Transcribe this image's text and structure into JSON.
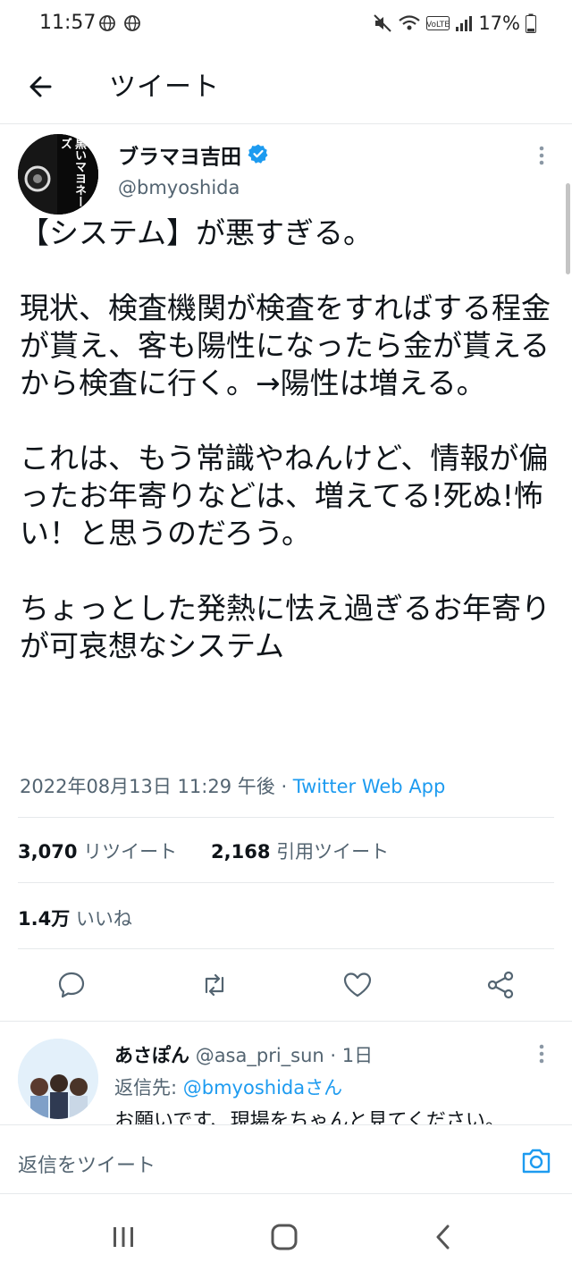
{
  "status_bar": {
    "time": "11:57",
    "battery": "17%",
    "icons": [
      "globe-icon",
      "globe-icon",
      "mute-icon",
      "wifi-icon",
      "volte-icon",
      "signal-icon",
      "battery-icon"
    ]
  },
  "header": {
    "title": "ツイート",
    "back_icon": "arrow-left-icon"
  },
  "tweet": {
    "author_name": "ブラマヨ吉田",
    "author_handle": "@bmyoshida",
    "avatar_text": "黒いマヨネーズ",
    "body": "【システム】が悪すぎる。\n\n現状、検査機関が検査をすればする程金が貰え、客も陽性になったら金が貰えるから検査に行く。→陽性は増える。\n\nこれは、もう常識やねんけど、情報が偏ったお年寄りなどは、増えてる!死ぬ!怖い！と思うのだろう。\n\nちょっとした発熱に怯え過ぎるお年寄りが可哀想なシステム",
    "timestamp": "2022年08月13日 11:29 午後",
    "separator": " · ",
    "source": "Twitter Web App",
    "retweets_count": "3,070",
    "retweets_label": "リツイート",
    "quotes_count": "2,168",
    "quotes_label": "引用ツイート",
    "likes_count": "1.4万",
    "likes_label": "いいね"
  },
  "reply": {
    "name": "あさぽん",
    "handle": "@asa_pri_sun",
    "time": "· 1日",
    "reply_to_label": "返信先:",
    "reply_to_handle": "@bmyoshidaさん",
    "text": "お願いです、現場をちゃんと見てください。"
  },
  "compose": {
    "placeholder": "返信をツイート"
  },
  "colors": {
    "accent": "#1d9bf0",
    "text": "#0f1419",
    "muted": "#536471",
    "divider": "#e6e9eb"
  }
}
